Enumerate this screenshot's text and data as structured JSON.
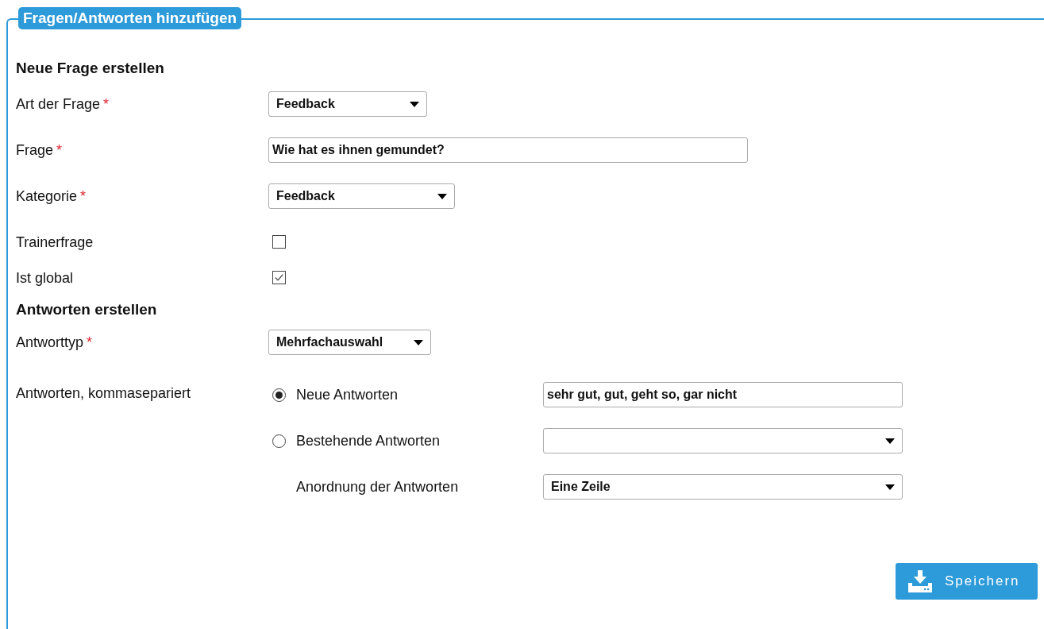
{
  "panel": {
    "title": "Fragen/Antworten hinzufügen"
  },
  "sections": [
    {
      "heading": "Neue Frage erstellen",
      "fields": [
        {
          "label": "Art der Frage",
          "required_mark": "*",
          "kind": "select",
          "value": "Feedback"
        },
        {
          "label": "Frage",
          "required_mark": "*",
          "kind": "text",
          "value": "Wie hat es ihnen gemundet?"
        },
        {
          "label": "Kategorie",
          "required_mark": "*",
          "kind": "select",
          "value": "Feedback"
        },
        {
          "label": "Trainerfrage",
          "kind": "checkbox",
          "checked": false
        },
        {
          "label": "Ist global",
          "kind": "checkbox",
          "checked": true
        }
      ]
    },
    {
      "heading": "Antworten erstellen",
      "fields": [
        {
          "label": "Antworttyp",
          "required_mark": "*",
          "kind": "select",
          "value": "Mehrfachauswahl"
        }
      ]
    }
  ],
  "answers": {
    "label": "Antworten, kommasepariert",
    "options": [
      {
        "label": "Neue Antworten",
        "selected": true,
        "kind": "text",
        "value": "sehr gut, gut, geht so, gar nicht"
      },
      {
        "label": "Bestehende Antworten",
        "selected": false,
        "kind": "select"
      }
    ],
    "ordering": {
      "label": "Anordnung der Antworten",
      "value": "Eine Zeile"
    }
  },
  "save_button": {
    "label": "Speichern"
  }
}
